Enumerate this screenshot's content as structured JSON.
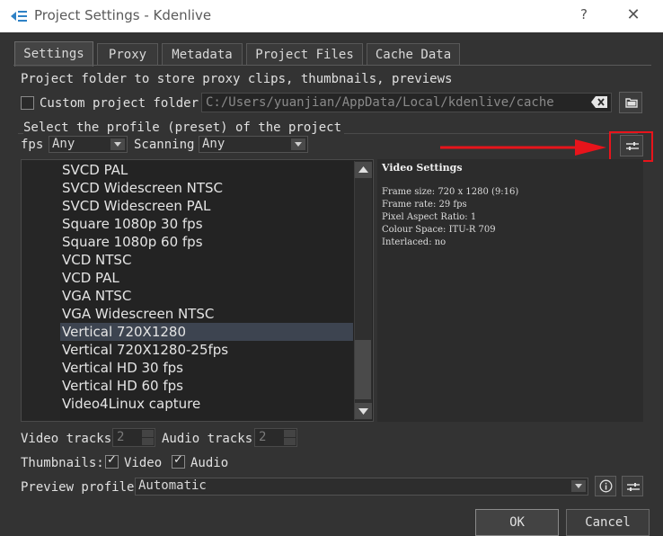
{
  "window": {
    "title": "Project Settings - Kdenlive",
    "help_label": "?",
    "close_label": "✕",
    "logo_icon": "kdenlive-logo",
    "accent_color": "#2f82c6"
  },
  "tabs": [
    {
      "label": "Settings",
      "active": true
    },
    {
      "label": "Proxy",
      "active": false
    },
    {
      "label": "Metadata",
      "active": false
    },
    {
      "label": "Project Files",
      "active": false
    },
    {
      "label": "Cache Data",
      "active": false
    }
  ],
  "settings": {
    "folder_description": "Project folder to store proxy clips, thumbnails, previews",
    "custom_folder_label": "Custom project folder",
    "custom_folder_checked": false,
    "folder_path": "C:/Users/yuanjian/AppData/Local/kdenlive/cache",
    "profile_section_label": "Select the profile (preset) of the project",
    "fps_label": "fps",
    "fps_value": "Any",
    "scanning_label": "Scanning",
    "scanning_value": "Any"
  },
  "profiles": {
    "items": [
      "SVCD PAL",
      "SVCD Widescreen NTSC",
      "SVCD Widescreen PAL",
      "Square 1080p 30 fps",
      "Square 1080p 60 fps",
      "VCD NTSC",
      "VCD PAL",
      "VGA NTSC",
      "VGA Widescreen NTSC",
      "Vertical 720X1280",
      "Vertical 720X1280-25fps",
      "Vertical HD 30 fps",
      "Vertical HD 60 fps",
      "Video4Linux capture"
    ],
    "selected": "Vertical 720X1280"
  },
  "video_settings": {
    "title": "Video Settings",
    "lines": [
      "Frame size: 720 x 1280 (9:16)",
      "Frame rate: 29 fps",
      "Pixel Aspect Ratio: 1",
      "Colour Space: ITU-R 709",
      "Interlaced: no"
    ]
  },
  "tracks": {
    "video_label": "Video tracks",
    "video_value": "2",
    "audio_label": "Audio tracks",
    "audio_value": "2"
  },
  "thumbnails": {
    "label": "Thumbnails:",
    "video_label": "Video",
    "video_checked": true,
    "audio_label": "Audio",
    "audio_checked": true
  },
  "preview": {
    "label": "Preview profile",
    "value": "Automatic"
  },
  "buttons": {
    "ok": "OK",
    "cancel": "Cancel"
  },
  "annotation": {
    "highlight_color": "#e8141b"
  }
}
